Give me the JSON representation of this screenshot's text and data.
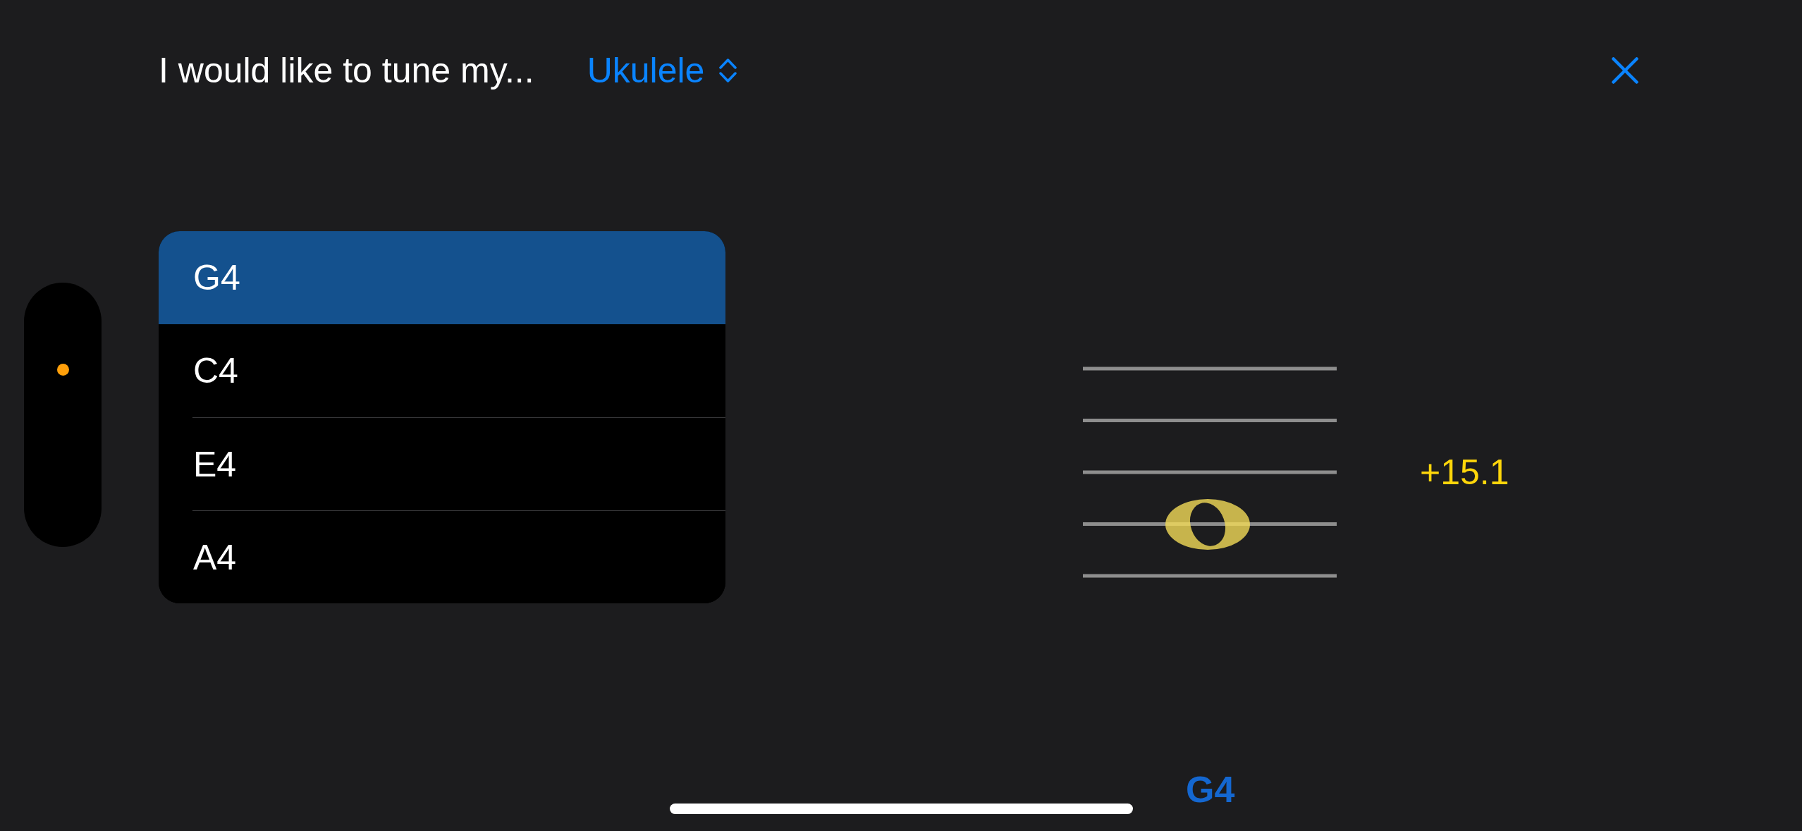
{
  "header": {
    "prompt": "I would like to tune my...",
    "instrument_picker": {
      "value": "Ukulele"
    }
  },
  "input_meter": {
    "level": 0.67
  },
  "strings": [
    {
      "note": "G4",
      "selected": true
    },
    {
      "note": "C4",
      "selected": false
    },
    {
      "note": "E4",
      "selected": false
    },
    {
      "note": "A4",
      "selected": false
    }
  ],
  "tuner": {
    "reading": "+15.1",
    "detected_note": "G4"
  }
}
